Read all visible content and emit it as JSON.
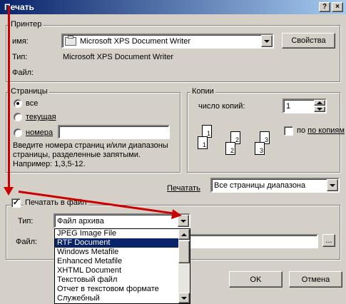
{
  "window": {
    "title": "Печать",
    "help_glyph": "?",
    "close_glyph": "×"
  },
  "printer": {
    "group_label": "Принтер",
    "name_label": "имя:",
    "name_value": "Microsoft XPS Document Writer",
    "properties_button": "Свойства",
    "type_label": "Тип:",
    "type_value": "Microsoft XPS Document Writer",
    "file_label": "Файл:"
  },
  "pages": {
    "group_label": "Страницы",
    "all_label": "все",
    "current_label": "текущая",
    "numbers_label": "номера",
    "numbers_value": "",
    "hint": "Введите номера страниц и/или диапазоны страницы, разделенные запятыми. Например: 1,3,5-12.",
    "selected": "all"
  },
  "copies": {
    "group_label": "Копии",
    "count_label": "число копий:",
    "count_value": "1",
    "collate_label": "по копиям",
    "collate_checked": false,
    "page_numbers": [
      "1",
      "1",
      "2",
      "2",
      "3",
      "3"
    ]
  },
  "print_range": {
    "label": "Печатать",
    "value": "Все страницы диапазона"
  },
  "print_to_file": {
    "label": "Печатать в файл",
    "checked": true,
    "check_glyph": "✓",
    "type_label": "Тип:",
    "type_value": "Файл архива",
    "file_label": "Файл:",
    "browse_label": "...",
    "options": [
      "JPEG Image File",
      "RTF Document",
      "Windows Metafile",
      "Enhanced Metafile",
      "XHTML Document",
      "Текстовый файл",
      "Отчет в текстовом формате",
      "Служебный"
    ],
    "selected_index": 1
  },
  "buttons": {
    "ok": "OK",
    "cancel": "Отмена"
  },
  "colors": {
    "annotation_arrow": "#cc0000",
    "selection": "#0a246a",
    "title_bar": "#0a246a"
  }
}
